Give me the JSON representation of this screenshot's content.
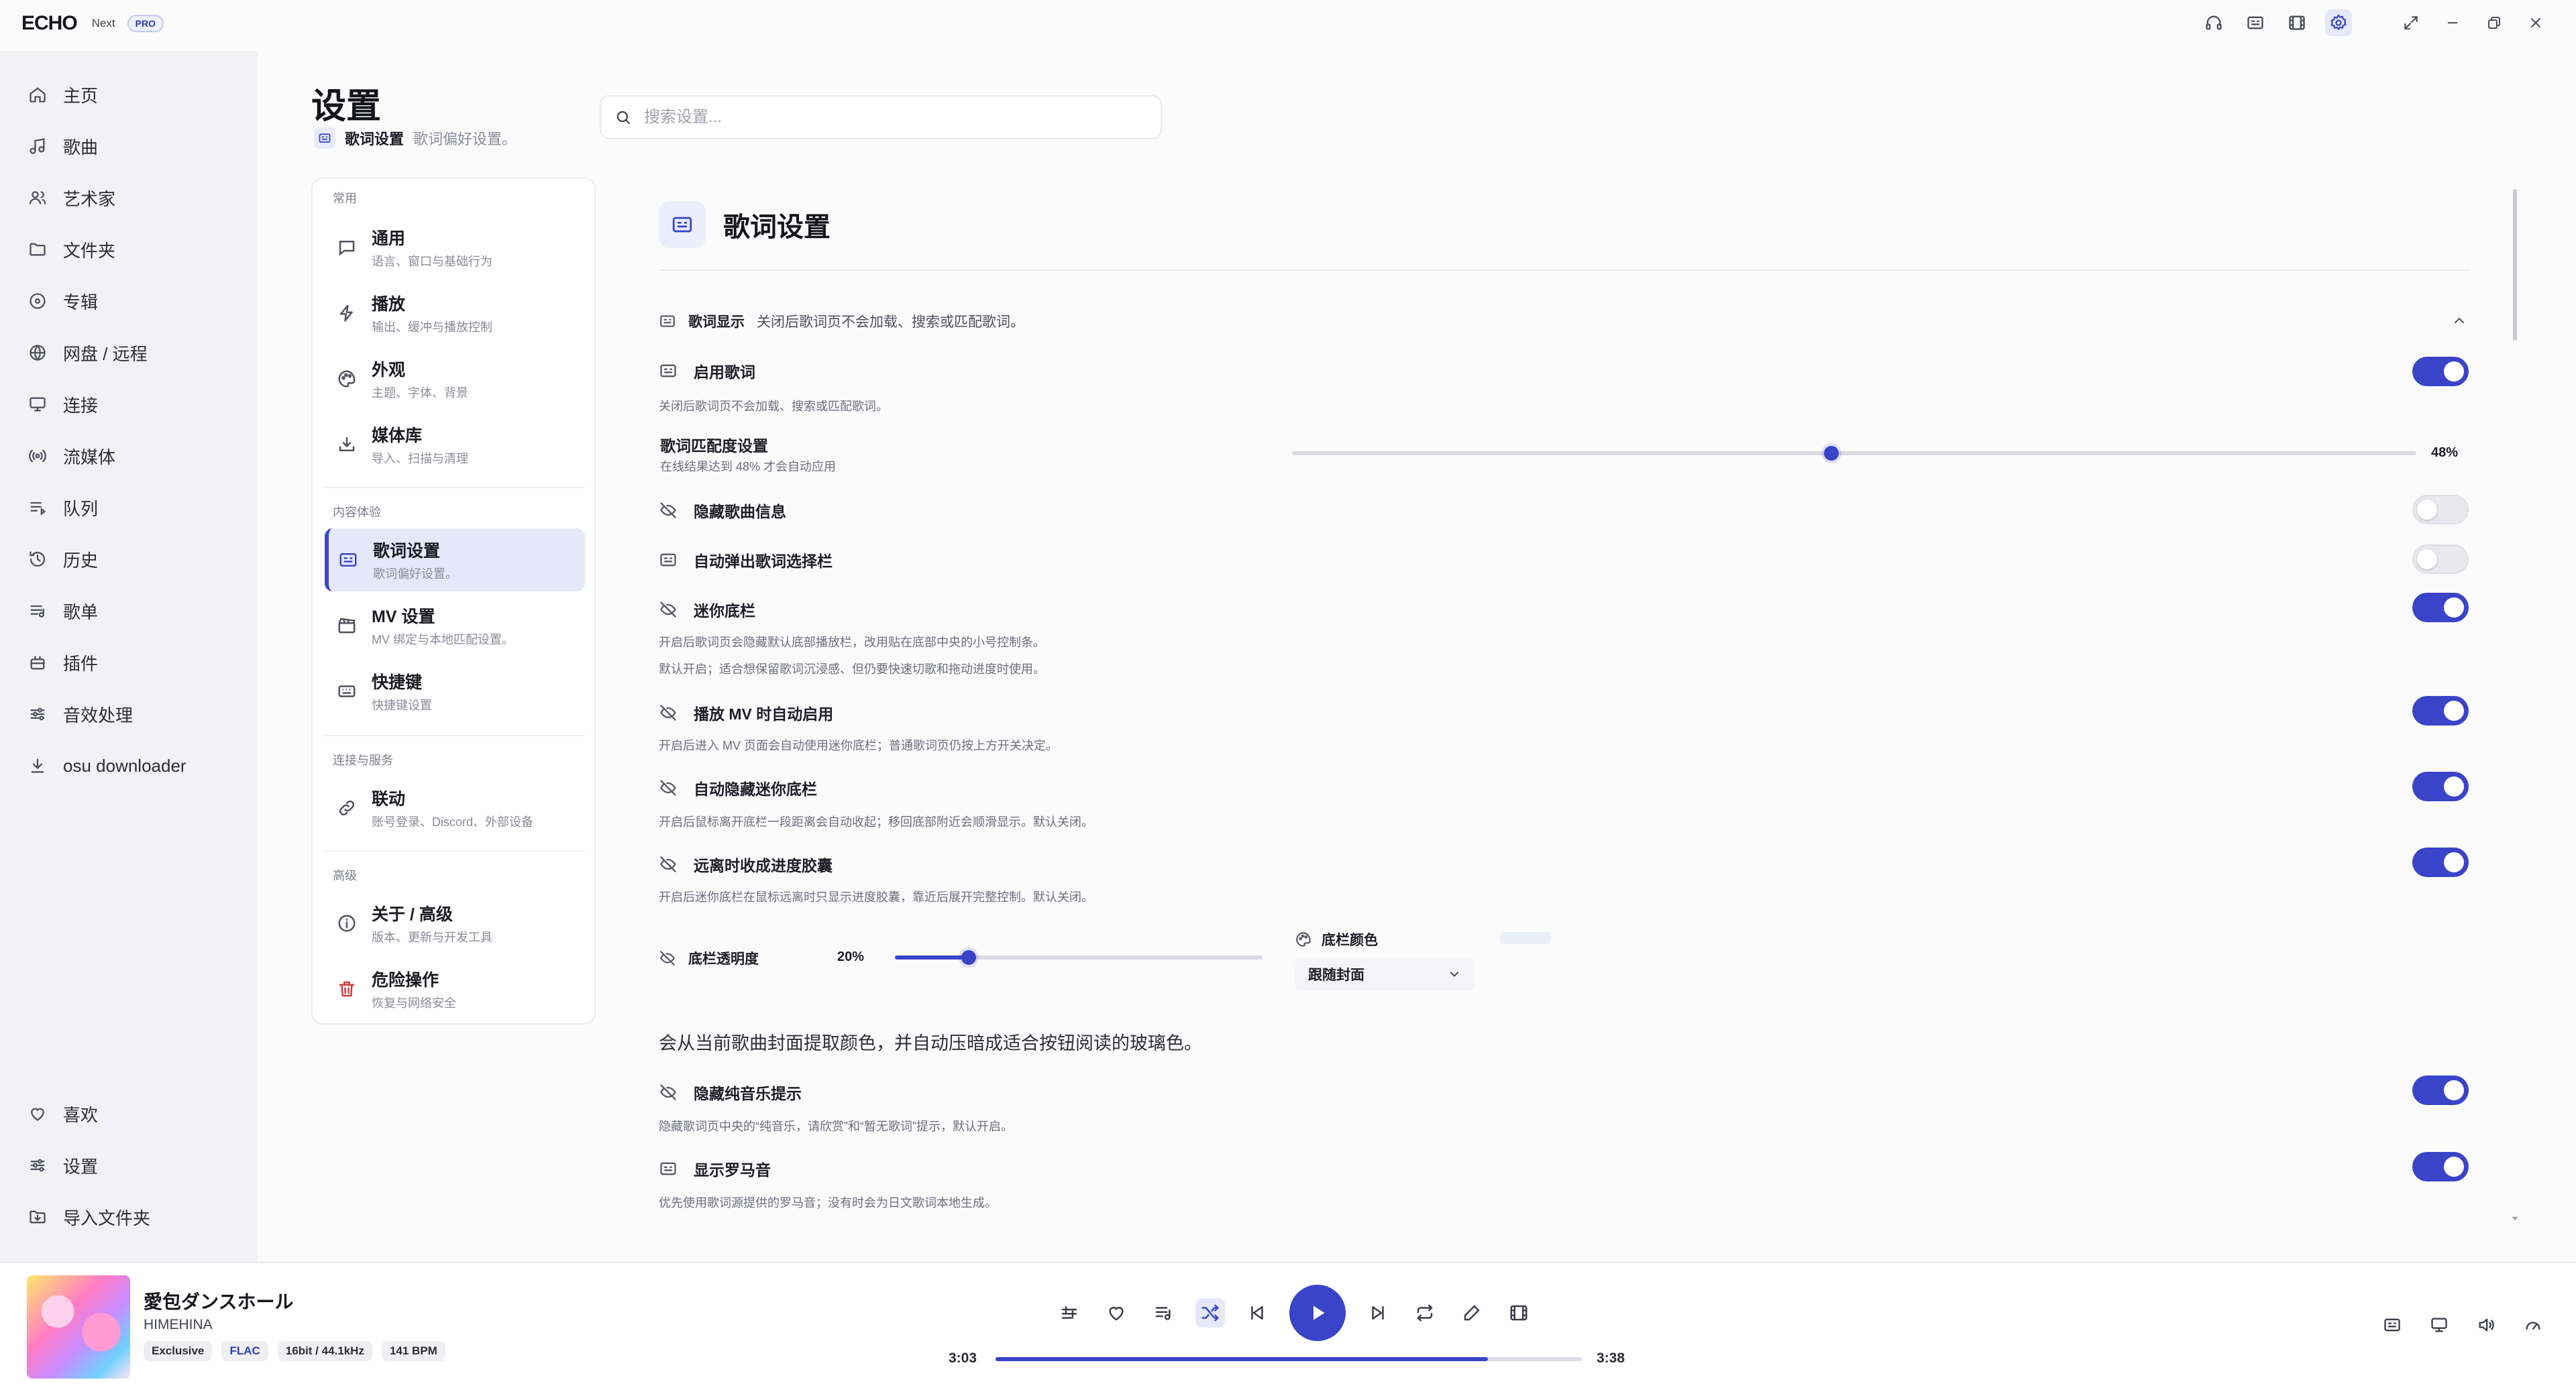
{
  "app": {
    "brand": "ECHO",
    "edition": "Next",
    "badge": "PRO"
  },
  "sidebar": {
    "items": [
      {
        "label": "主页",
        "icon": "home-icon"
      },
      {
        "label": "歌曲",
        "icon": "music-note-icon"
      },
      {
        "label": "艺术家",
        "icon": "users-icon"
      },
      {
        "label": "文件夹",
        "icon": "folder-icon"
      },
      {
        "label": "专辑",
        "icon": "disc-icon"
      },
      {
        "label": "网盘 / 远程",
        "icon": "globe-icon"
      },
      {
        "label": "连接",
        "icon": "cast-icon"
      },
      {
        "label": "流媒体",
        "icon": "broadcast-icon"
      },
      {
        "label": "队列",
        "icon": "queue-icon"
      },
      {
        "label": "历史",
        "icon": "history-icon"
      },
      {
        "label": "歌单",
        "icon": "playlist-icon"
      },
      {
        "label": "插件",
        "icon": "plugin-icon"
      },
      {
        "label": "音效处理",
        "icon": "equalizer-icon"
      },
      {
        "label": "osu downloader",
        "icon": "download-icon"
      }
    ],
    "bottom": [
      {
        "label": "喜欢",
        "icon": "heart-icon"
      },
      {
        "label": "设置",
        "icon": "settings-sliders-icon"
      },
      {
        "label": "导入文件夹",
        "icon": "folder-import-icon"
      }
    ]
  },
  "page": {
    "title": "设置",
    "breadcrumb_current": "歌词设置",
    "breadcrumb_sub": "歌词偏好设置。",
    "search_placeholder": "搜索设置..."
  },
  "categories": {
    "groups": {
      "common": "常用",
      "content": "内容体验",
      "connect": "连接与服务",
      "advanced": "高级"
    },
    "items": [
      {
        "title": "通用",
        "sub": "语言、窗口与基础行为",
        "icon": "chat-icon"
      },
      {
        "title": "播放",
        "sub": "输出、缓冲与播放控制",
        "icon": "lightning-icon"
      },
      {
        "title": "外观",
        "sub": "主题、字体、背景",
        "icon": "palette-icon"
      },
      {
        "title": "媒体库",
        "sub": "导入、扫描与清理",
        "icon": "download-tray-icon"
      },
      {
        "title": "歌词设置",
        "sub": "歌词偏好设置。",
        "icon": "lyrics-icon"
      },
      {
        "title": "MV 设置",
        "sub": "MV 绑定与本地匹配设置。",
        "icon": "clapperboard-icon"
      },
      {
        "title": "快捷键",
        "sub": "快捷键设置",
        "icon": "keyboard-icon"
      },
      {
        "title": "联动",
        "sub": "账号登录、Discord、外部设备",
        "icon": "link-icon"
      },
      {
        "title": "关于 / 高级",
        "sub": "版本、更新与开发工具",
        "icon": "info-icon"
      },
      {
        "title": "危险操作",
        "sub": "恢复与网络安全",
        "icon": "trash-icon"
      }
    ]
  },
  "panel": {
    "title": "歌词设置",
    "section_title": "歌词显示",
    "section_desc": "关闭后歌词页不会加载、搜索或匹配歌词。",
    "enable_lyrics": {
      "title": "启用歌词",
      "desc": "关闭后歌词页不会加载、搜索或匹配歌词。",
      "on": true
    },
    "match": {
      "title": "歌词匹配度设置",
      "desc": "在线结果达到 48% 才会自动应用",
      "value_label": "48%",
      "value": 0.48
    },
    "hide_info": {
      "title": "隐藏歌曲信息",
      "on": false
    },
    "auto_popup": {
      "title": "自动弹出歌词选择栏",
      "on": false
    },
    "mini_bar": {
      "title": "迷你底栏",
      "desc1": "开启后歌词页会隐藏默认底部播放栏，改用贴在底部中央的小号控制条。",
      "desc2": "默认开启；适合想保留歌词沉浸感、但仍要快速切歌和拖动进度时使用。",
      "on": true
    },
    "mv_auto": {
      "title": "播放 MV 时自动启用",
      "desc": "开启后进入 MV 页面会自动使用迷你底栏；普通歌词页仍按上方开关决定。",
      "on": true
    },
    "auto_hide": {
      "title": "自动隐藏迷你底栏",
      "desc": "开启后鼠标离开底栏一段距离会自动收起；移回底部附近会顺滑显示。默认关闭。",
      "on": true
    },
    "capsule": {
      "title": "远离时收成进度胶囊",
      "desc": "开启后迷你底栏在鼠标远离时只显示进度胶囊，靠近后展开完整控制。默认关闭。",
      "on": true
    },
    "opacity": {
      "label": "底栏透明度",
      "value_label": "20%",
      "value": 0.2
    },
    "bar_color": {
      "label": "底栏颜色",
      "selected": "跟随封面"
    },
    "color_note": "会从当前歌曲封面提取颜色，并自动压暗成适合按钮阅读的玻璃色。",
    "hide_pure": {
      "title": "隐藏纯音乐提示",
      "desc": "隐藏歌词页中央的“纯音乐，请欣赏”和“暂无歌词”提示，默认开启。",
      "on": true
    },
    "romaji": {
      "title": "显示罗马音",
      "desc": "优先使用歌词源提供的罗马音；没有时会为日文歌词本地生成。",
      "on": true
    }
  },
  "player": {
    "title": "愛包ダンスホール",
    "artist": "HIMEHINA",
    "badges": [
      "Exclusive",
      "FLAC",
      "16bit / 44.1kHz",
      "141 BPM"
    ],
    "time_current": "3:03",
    "time_total": "3:38",
    "progress": 0.84
  },
  "colors": {
    "accent": "#3944c9"
  }
}
